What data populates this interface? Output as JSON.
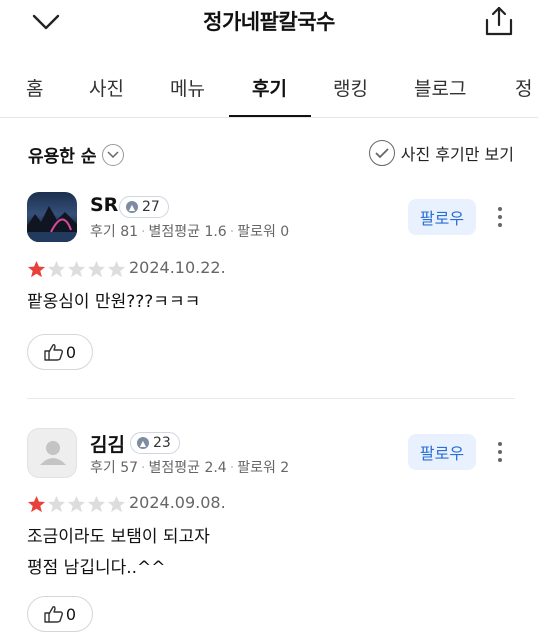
{
  "header": {
    "title": "정가네팥칼국수"
  },
  "tabs": [
    "홈",
    "사진",
    "메뉴",
    "후기",
    "랭킹",
    "블로그",
    "정"
  ],
  "sort": {
    "label": "유용한 순",
    "photo_only_label": "사진 후기만 보기"
  },
  "reviews": [
    {
      "name": "SR",
      "level": "27",
      "reviews": "후기 81",
      "avg_rating": "별점평균 1.6",
      "followers": "팔로워 0",
      "follow_label": "팔로우",
      "rating": 1,
      "date": "2024.10.22.",
      "lines": [
        "팥옹심이 만원???ㅋㅋㅋ"
      ],
      "likes": "0"
    },
    {
      "name": "김김",
      "level": "23",
      "reviews": "후기 57",
      "avg_rating": "별점평균 2.4",
      "followers": "팔로워 2",
      "follow_label": "팔로우",
      "rating": 1,
      "date": "2024.09.08.",
      "lines": [
        "조금이라도 보탬이 되고자",
        "평점 남깁니다..^^"
      ],
      "likes": "0"
    }
  ],
  "colors": {
    "accent": "#2a6fd6",
    "follow_bg": "#e8f1fd",
    "star_filled": "#e8403a",
    "star_empty": "#dddddd"
  }
}
